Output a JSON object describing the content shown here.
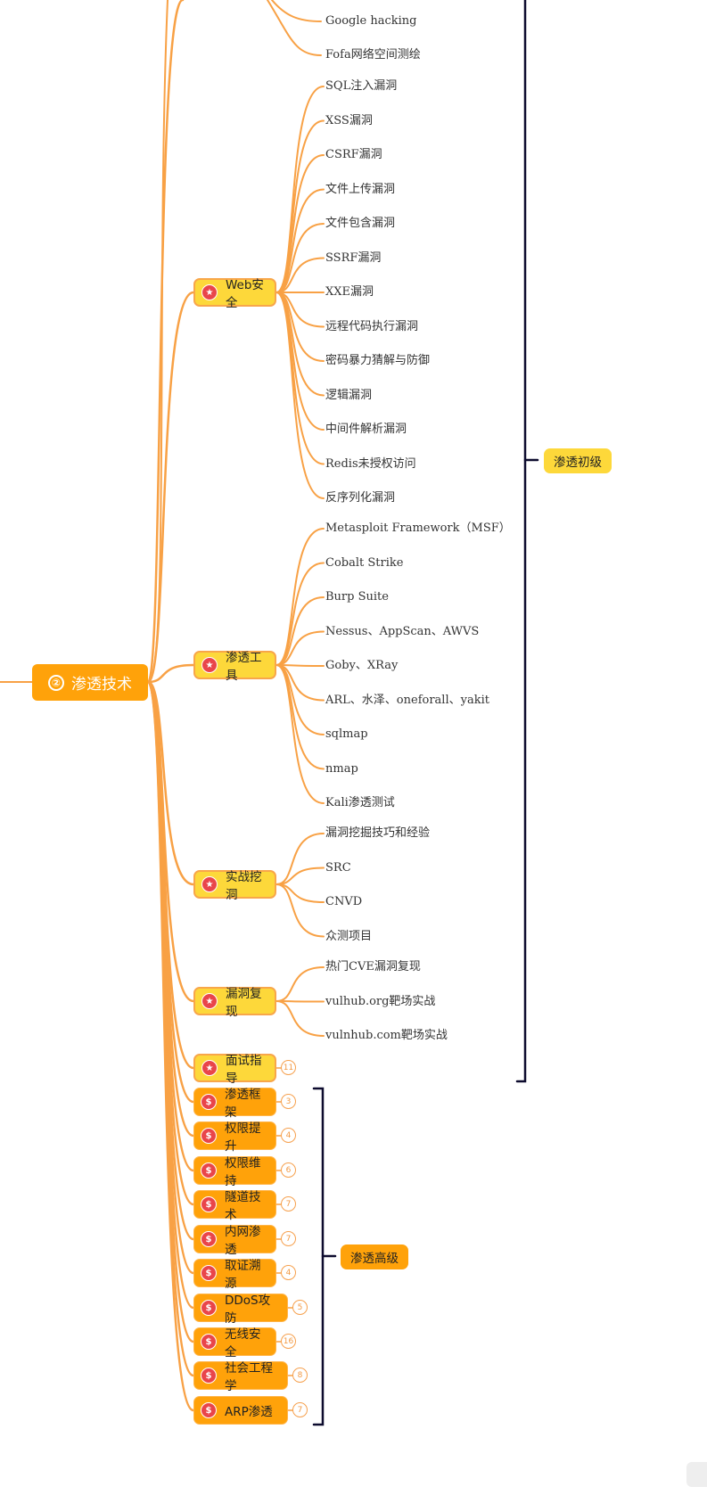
{
  "root": {
    "number": "②",
    "label": "渗透技术"
  },
  "top_leaves": [
    "Google hacking",
    "Fofa网络空间测绘"
  ],
  "groups": [
    {
      "label": "Web安全",
      "icon": "star-icon",
      "leaves": [
        "SQL注入漏洞",
        "XSS漏洞",
        "CSRF漏洞",
        "文件上传漏洞",
        "文件包含漏洞",
        "SSRF漏洞",
        "XXE漏洞",
        "远程代码执行漏洞",
        "密码暴力猜解与防御",
        "逻辑漏洞",
        "中间件解析漏洞",
        "Redis未授权访问",
        "反序列化漏洞"
      ]
    },
    {
      "label": "渗透工具",
      "icon": "star-icon",
      "leaves": [
        "Metasploit Framework（MSF）",
        "Cobalt Strike",
        "Burp Suite",
        "Nessus、AppScan、AWVS",
        "Goby、XRay",
        "ARL、水泽、oneforall、yakit",
        "sqlmap",
        "nmap",
        "Kali渗透测试"
      ]
    },
    {
      "label": "实战挖洞",
      "icon": "star-icon",
      "leaves": [
        "漏洞挖掘技巧和经验",
        "SRC",
        "CNVD",
        "众测项目"
      ]
    },
    {
      "label": "漏洞复现",
      "icon": "star-icon",
      "leaves": [
        "热门CVE漏洞复现",
        "vulhub.org靶场实战",
        "vulnhub.com靶场实战"
      ]
    },
    {
      "label": "面试指导",
      "icon": "star-icon",
      "collapsed_count": "11"
    }
  ],
  "advanced": [
    {
      "label": "渗透框架",
      "count": "3"
    },
    {
      "label": "权限提升",
      "count": "4"
    },
    {
      "label": "权限维持",
      "count": "6"
    },
    {
      "label": "隧道技术",
      "count": "7"
    },
    {
      "label": "内网渗透",
      "count": "7"
    },
    {
      "label": "取证溯源",
      "count": "4"
    },
    {
      "label": "DDoS攻防",
      "count": "5"
    },
    {
      "label": "无线安全",
      "count": "16"
    },
    {
      "label": "社会工程学",
      "count": "8"
    },
    {
      "label": "ARP渗透",
      "count": "7"
    }
  ],
  "summaries": {
    "beginner": "渗透初级",
    "advanced": "渗透高级"
  },
  "colors": {
    "branch": "#f8a145",
    "root": "#ffa20a",
    "star_node": "#fdd83a",
    "adv_node": "#ffa20a",
    "icon": "#e9454a",
    "bracket": "#0d0b2e"
  }
}
